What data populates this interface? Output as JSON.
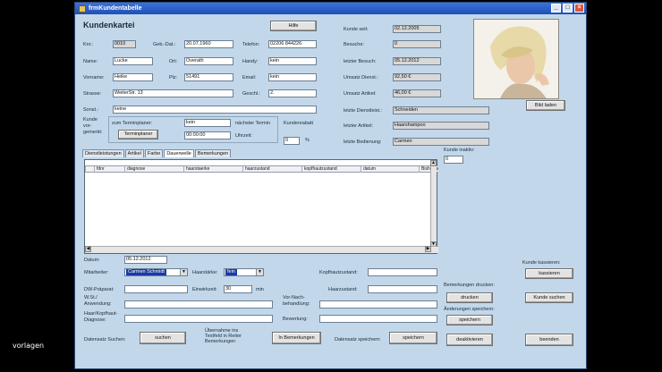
{
  "watermark": "vorlagen",
  "window": {
    "title": "frmKundentabelle"
  },
  "header": {
    "title": "Kundenkartei",
    "hilfe_button": "Hilfe"
  },
  "customer": {
    "knr_label": "Knr.:",
    "knr": "0010",
    "geb_label": "Geb.-Dat.:",
    "geb": "20.07.1960",
    "telefon_label": "Telefon:",
    "telefon": "02206 844226",
    "name_label": "Name:",
    "name": "Lucke",
    "ort_label": "Ort:",
    "ort": "Overath",
    "handy_label": "Handy:",
    "handy": "kein",
    "vorname_label": "Vorname:",
    "vorname": "Heike",
    "plz_label": "Plz:",
    "plz": "51491",
    "email_label": "Email:",
    "email": "kein",
    "strasse_label": "Strasse:",
    "strasse": "WeiterStr. 13",
    "geschl_label": "Geschl.:",
    "geschl": "2.",
    "sonst_label": "Sonst.:",
    "sonst": "keine",
    "kunde_vorgemerkt_label": "Kunde vor-gemerkt:",
    "termin_label": "zum Terminplaner:",
    "termin_value": "kein",
    "naechster_termin_label": "nächster Termin",
    "uhrzeit_label": "Uhrzeit:",
    "uhrzeit": "00:00:00",
    "terminplaner_button": "Terminplaner",
    "kundenrabatt_label": "Kundenrabatt",
    "kundenrabatt": "0",
    "percent": "%"
  },
  "stats": {
    "kunde_seit_label": "Kunde seit:",
    "kunde_seit": "02.12.2005",
    "besuche_label": "Besuche:",
    "besuche": "0",
    "letzter_besuch_label": "letzter Besuch:",
    "letzter_besuch": "05.12.2012",
    "umsatz_dienst_label": "Umsatz Dienst.:",
    "umsatz_dienst": "92,50 €",
    "umsatz_artikel_label": "Umsatz Artikel:",
    "umsatz_artikel": "46,00 €",
    "letzte_dienstleist_label": "letzte Dienstleist.:",
    "letzte_dienstleist": "Schneiden",
    "letzter_artikel_label": "letzter Artikel:",
    "letzter_artikel": "Haarshampoo",
    "letzte_bedienung_label": "letzte Bedienung:",
    "letzte_bedienung": "Carmen"
  },
  "photo": {
    "bild_laden_button": "Bild laden"
  },
  "tabs": [
    "Dienstleistungen",
    "Artikel",
    "Farbe",
    "Dauerwelle",
    "Bemerkungen"
  ],
  "table": {
    "columns": [
      "fdnr",
      "diagnose",
      "haarstaerke",
      "haarzustand",
      "kopfhautzustand",
      "datum",
      "Bisheriges"
    ]
  },
  "kunde_inaktiv": {
    "label": "Kunde inaktiv:",
    "value": "0"
  },
  "detail": {
    "datum_label": "Datum:",
    "datum": "05.12.2012",
    "mitarbeiter_label": "Mitarbeiter:",
    "mitarbeiter": "Carmen Schmidt",
    "haarstaerke_label": "Haarstärke:",
    "haarstaerke": "fein",
    "kopfhautzustand_label": "Kopfhautzustand:",
    "dw_praeparat_label": "DW-Präparat:",
    "einwirkzeit_label": "Einwirkzeit:",
    "einwirkzeit": "30",
    "min": "min",
    "haarzustand_label": "Haarzustand:",
    "anwendung_label": "W.St./ Anwendung:",
    "vor_nach_label": "Vor-Nach-behandlung:",
    "haar_kopfhaut_label": "Haar/Kopfhaut-Diagnose:",
    "bewertung_label": "Bewertung:",
    "datensatz_suchen_label": "Datensatz Suchen:",
    "suchen_button": "suchen",
    "uebernahme_label": "Übernahme ins Textfeld in Reiter Bemerkungen",
    "in_bemerkungen_button": "In Bemerkungen",
    "datensatz_speichern_label": "Datensatz speichern:",
    "speichern_button": "speichern"
  },
  "side": {
    "kunde_kassieren_label": "Kunde kassieren:",
    "kassieren_button": "kassieren",
    "bemerkungen_drucken_label": "Bemerkungen drucken:",
    "drucken_button": "drucken",
    "kunde_suchen_button": "Kunde suchen",
    "aenderungen_speichern_label": "Änderungen speichern:",
    "speichern_button": "speichern",
    "deaktivieren_button": "deaktivieren",
    "beenden_button": "beenden"
  }
}
